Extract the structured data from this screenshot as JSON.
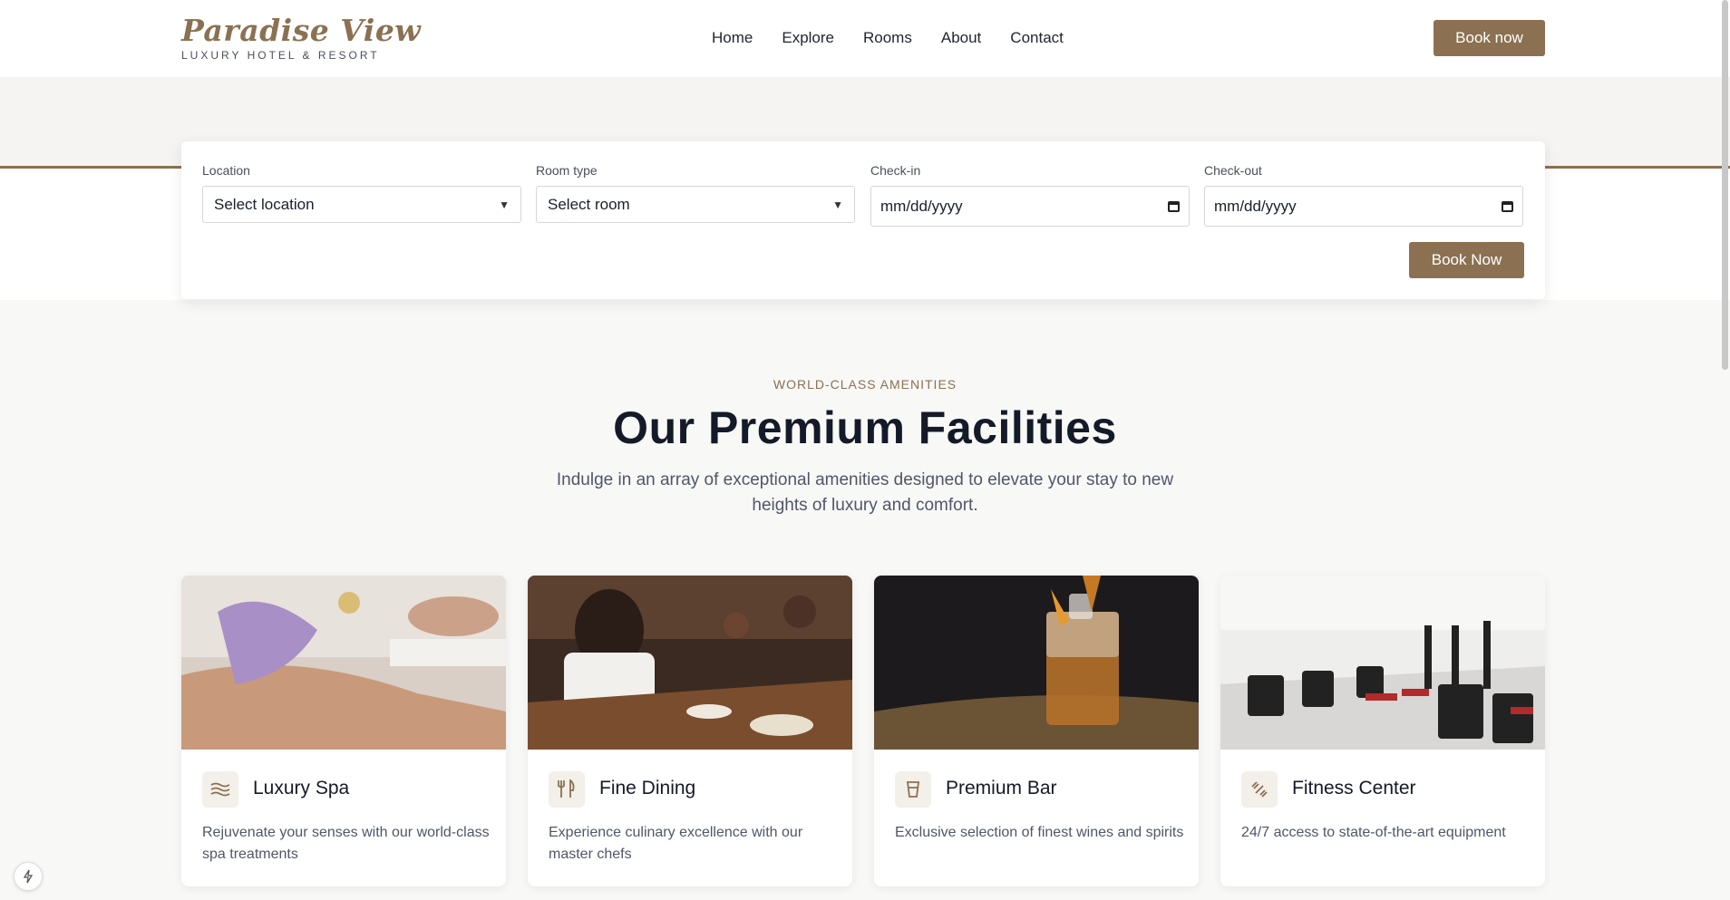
{
  "brand": {
    "name": "Paradise View",
    "tagline": "LUXURY HOTEL & RESORT"
  },
  "nav": {
    "items": [
      "Home",
      "Explore",
      "Rooms",
      "About",
      "Contact"
    ],
    "cta": "Book now"
  },
  "booking": {
    "location": {
      "label": "Location",
      "value": "Select location"
    },
    "room_type": {
      "label": "Room type",
      "value": "Select room"
    },
    "check_in": {
      "label": "Check-in",
      "value": "mm/dd/yyyy"
    },
    "check_out": {
      "label": "Check-out",
      "value": "mm/dd/yyyy"
    },
    "submit": "Book Now"
  },
  "amenities": {
    "eyebrow": "WORLD-CLASS AMENITIES",
    "title": "Our Premium Facilities",
    "lead": "Indulge in an array of exceptional amenities designed to elevate your stay to new heights of luxury and comfort.",
    "cards": [
      {
        "title": "Luxury Spa",
        "desc": "Rejuvenate your senses with our world-class spa treatments",
        "icon": "waves-icon"
      },
      {
        "title": "Fine Dining",
        "desc": "Experience culinary excellence with our master chefs",
        "icon": "utensils-icon"
      },
      {
        "title": "Premium Bar",
        "desc": "Exclusive selection of finest wines and spirits",
        "icon": "glass-icon"
      },
      {
        "title": "Fitness Center",
        "desc": "24/7 access to state-of-the-art equipment",
        "icon": "dumbbell-icon"
      }
    ]
  },
  "colors": {
    "accent": "#8b7152",
    "heading": "#151a28",
    "body": "#50566a",
    "background": "#f8f8f7"
  }
}
